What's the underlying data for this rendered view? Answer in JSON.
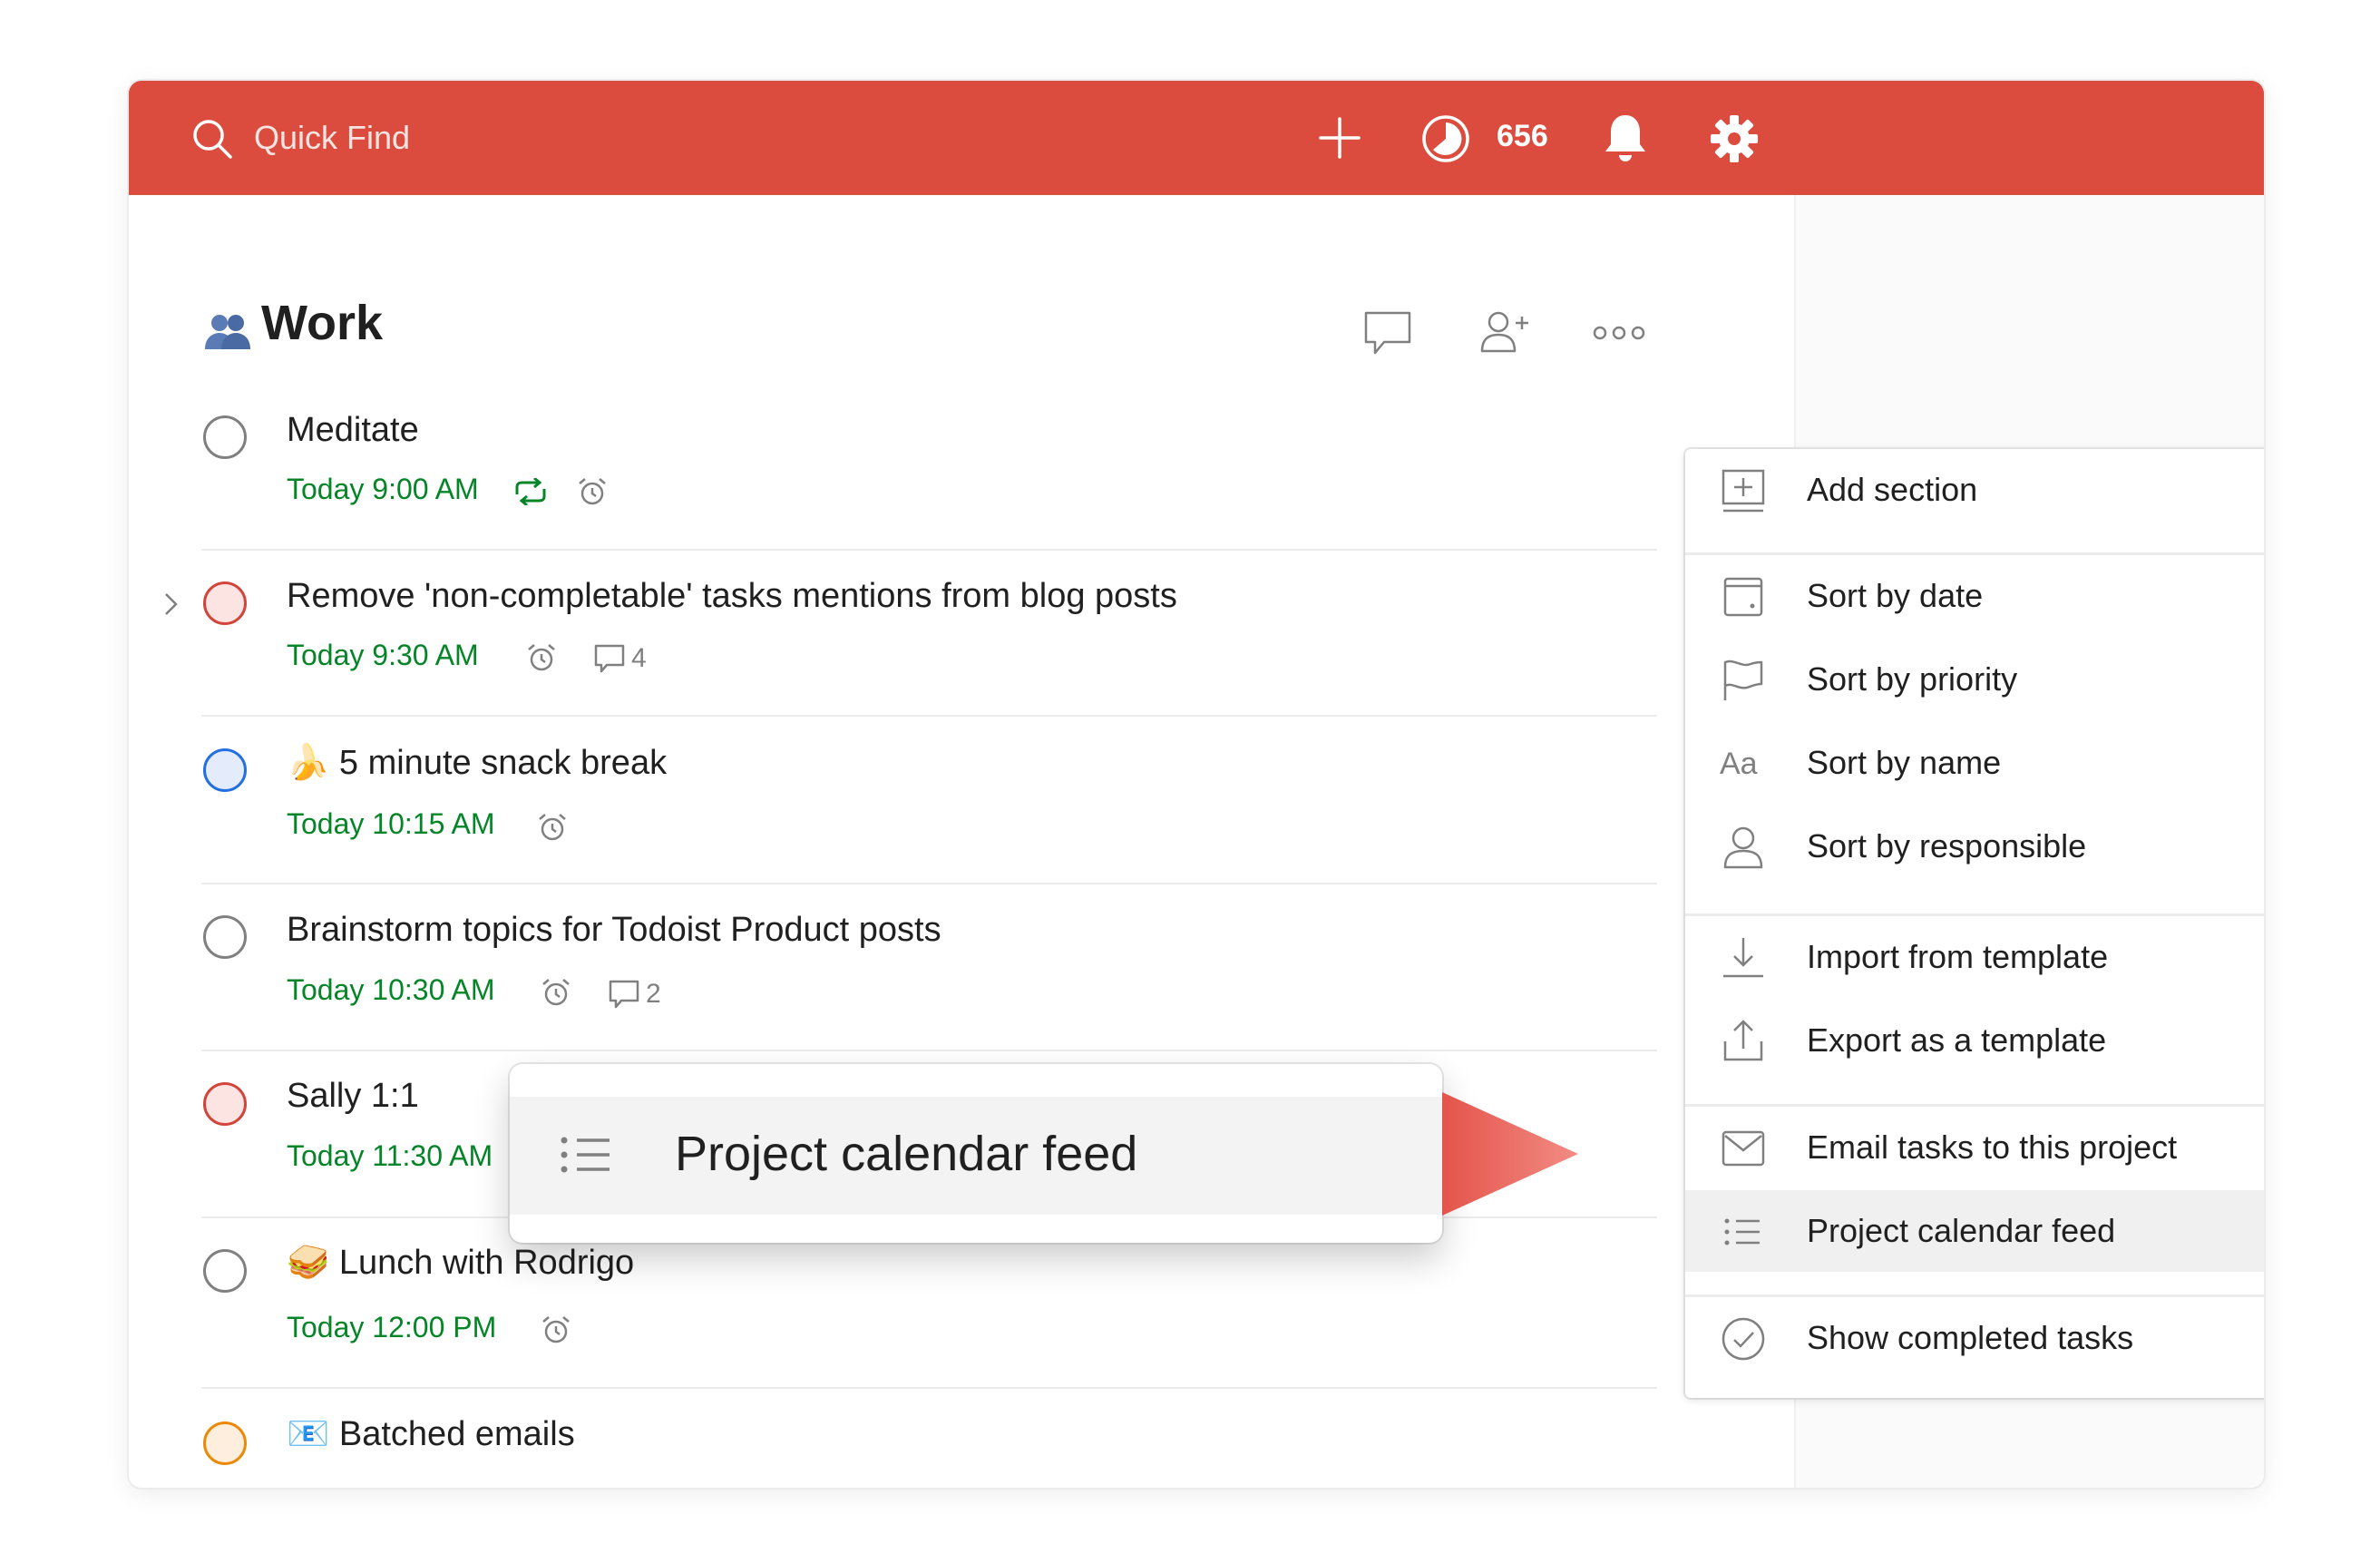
{
  "topbar": {
    "search_placeholder": "Quick Find",
    "karma": "656",
    "color": "#db4c3f"
  },
  "project": {
    "title": "Work",
    "icon": "shared-project-icon"
  },
  "tasks": [
    {
      "title": "Meditate",
      "due": "Today 9:00 AM",
      "priority": "none",
      "icons": [
        "recurring-icon",
        "alarm-icon"
      ]
    },
    {
      "title": "Remove 'non-completable' tasks mentions from blog posts",
      "due": "Today 9:30 AM",
      "priority": "p1",
      "icons": [
        "alarm-icon",
        "comment-icon"
      ],
      "comments": "4",
      "has_subtasks": true
    },
    {
      "title": "5 minute snack break",
      "emoji": "🍌",
      "due": "Today 10:15 AM",
      "priority": "p2",
      "icons": [
        "alarm-icon"
      ]
    },
    {
      "title": "Brainstorm topics for Todoist Product posts",
      "due": "Today 10:30 AM",
      "priority": "none",
      "icons": [
        "alarm-icon",
        "comment-icon"
      ],
      "comments": "2"
    },
    {
      "title": "Sally 1:1",
      "due": "Today 11:30 AM",
      "priority": "p1",
      "icons": []
    },
    {
      "title": "Lunch with Rodrigo",
      "emoji": "🥪",
      "due": "Today 12:00 PM",
      "priority": "none",
      "icons": [
        "alarm-icon"
      ]
    },
    {
      "title": "Batched emails",
      "emoji": "📧",
      "due": "",
      "priority": "p3",
      "icons": []
    }
  ],
  "menu": {
    "items": [
      {
        "label": "Add section",
        "icon": "add-section-icon"
      },
      {
        "label": "Sort by date",
        "icon": "calendar-icon"
      },
      {
        "label": "Sort by priority",
        "icon": "flag-icon"
      },
      {
        "label": "Sort by name",
        "icon": "text-aa-icon",
        "icon_text": "Aa"
      },
      {
        "label": "Sort by responsible",
        "icon": "person-icon"
      },
      {
        "label": "Import from template",
        "icon": "download-icon"
      },
      {
        "label": "Export as a template",
        "icon": "upload-icon"
      },
      {
        "label": "Email tasks to this project",
        "icon": "email-icon"
      },
      {
        "label": "Project calendar feed",
        "icon": "list-icon",
        "active": true
      },
      {
        "label": "Show completed tasks",
        "icon": "check-circle-icon"
      }
    ]
  },
  "zoom": {
    "label": "Project calendar feed"
  }
}
